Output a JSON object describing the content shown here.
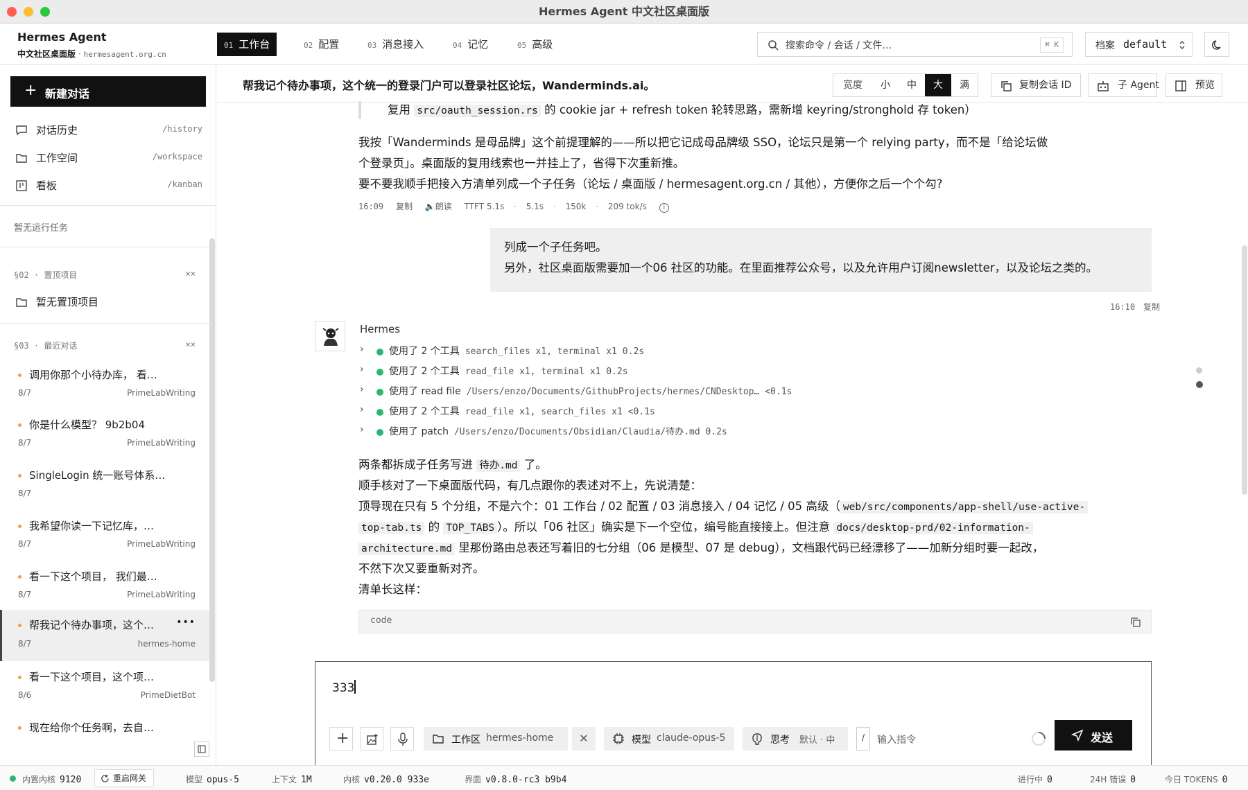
{
  "window": {
    "title": "Hermes Agent 中文社区桌面版"
  },
  "brand": {
    "name": "Hermes Agent",
    "subtitle": "中文社区桌面版",
    "separator": "·",
    "domain": "hermesagent.org.cn"
  },
  "tabs": [
    {
      "num": "01",
      "label": "工作台",
      "active": true
    },
    {
      "num": "02",
      "label": "配置"
    },
    {
      "num": "03",
      "label": "消息接入"
    },
    {
      "num": "04",
      "label": "记忆"
    },
    {
      "num": "05",
      "label": "高级"
    }
  ],
  "search": {
    "placeholder": "搜索命令 / 会话 / 文件…",
    "shortcut": "⌘ K"
  },
  "profile": {
    "label": "档案",
    "value": "default"
  },
  "sidebar": {
    "new_chat": "新建对话",
    "nav": [
      {
        "label": "对话历史",
        "path": "/history"
      },
      {
        "label": "工作空间",
        "path": "/workspace"
      },
      {
        "label": "看板",
        "path": "/kanban"
      }
    ],
    "no_tasks": "暂无运行任务",
    "pinned_header": "§02 · 置顶项目",
    "pinned_close": "××",
    "pinned_empty": "暂无置顶项目",
    "recent_header": "§03 · 最近对话",
    "recent_close": "××",
    "conversations": [
      {
        "title": "调用你那个小待办库， 看…",
        "date": "8/7",
        "project": "PrimeLabWriting"
      },
      {
        "title": "你是什么模型？ 9b2b04",
        "date": "8/7",
        "project": "PrimeLabWriting"
      },
      {
        "title": "SingleLogin 统一账号体系…",
        "date": "8/7",
        "project": ""
      },
      {
        "title": "我希望你读一下记忆库，…",
        "date": "8/7",
        "project": "PrimeLabWriting"
      },
      {
        "title": "看一下这个项目， 我们最…",
        "date": "8/7",
        "project": "PrimeLabWriting"
      },
      {
        "title": "帮我记个待办事项，这个…",
        "date": "8/7",
        "project": "hermes-home",
        "selected": true,
        "more": "•••"
      },
      {
        "title": "看一下这个项目，这个项…",
        "date": "8/6",
        "project": "PrimeDietBot"
      },
      {
        "title": "现在给你个任务啊，去自…",
        "date": "",
        "project": ""
      }
    ]
  },
  "conversation": {
    "title": "帮我记个待办事项，这个统一的登录门户可以登录社区论坛，Wanderminds.ai。",
    "width_label": "宽度",
    "widths": [
      "小",
      "中",
      "大",
      "满"
    ],
    "active_width": "大",
    "copy_id": "复制会话 ID",
    "sub_agent": "子 Agent",
    "preview": "预览"
  },
  "messages": {
    "prev_line_a": "复用",
    "prev_line_code": "src/oauth_session.rs",
    "prev_line_b": "的 cookie jar + refresh token 轮转思路，需新增 keyring/stronghold 存 token）",
    "prev_p1": "我按「Wanderminds 是母品牌」这个前提理解的——所以把它记成母品牌级 SSO，论坛只是第一个 relying party，而不是「给论坛做",
    "prev_p2": "个登录页」。桌面版的复用线索也一并挂上了，省得下次重新推。",
    "prev_p3": "要不要我顺手把接入方清单列成一个子任务（论坛 / 桌面版 / hermesagent.org.cn / 其他），方便你之后一个个勾?",
    "prev_meta": {
      "time": "16:09",
      "copy": "复制",
      "read": "朗读",
      "ttft": "TTFT 5.1s",
      "dur": "5.1s",
      "tokens": "150k",
      "speed": "209 tok/s"
    },
    "user_line1": "列成一个子任务吧。",
    "user_line2": "另外，社区桌面版需要加一个06 社区的功能。在里面推荐公众号，以及允许用户订阅newsletter，以及论坛之类的。",
    "user_meta": {
      "time": "16:10",
      "copy": "复制"
    },
    "agent_name": "Hermes",
    "tools": [
      {
        "label": "使用了 2 个工具",
        "detail": "search_files x1, terminal x1 0.2s"
      },
      {
        "label": "使用了 2 个工具",
        "detail": "read_file x1, terminal x1 0.2s"
      },
      {
        "label": "使用了 read file",
        "detail": "/Users/enzo/Documents/GithubProjects/hermes/CNDesktop… <0.1s"
      },
      {
        "label": "使用了 2 个工具",
        "detail": "read_file x1, search_files x1 <0.1s"
      },
      {
        "label": "使用了 patch",
        "detail": "/Users/enzo/Documents/Obsidian/Claudia/待办.md 0.2s"
      }
    ],
    "r1a": "两条都拆成子任务写进",
    "r1code": "待办.md",
    "r1b": "了。",
    "r2": "顺手核对了一下桌面版代码，有几点跟你的表述对不上，先说清楚：",
    "r3a": "顶导现在只有 5 个分组，不是六个：01 工作台 / 02 配置 / 03 消息接入 / 04 记忆 / 05 高级（",
    "r3code": "web/src/components/app-shell/use-active-",
    "r4code1": "top-tab.ts",
    "r4a": "的",
    "r4code2": "TOP_TABS",
    "r4b": "）。所以「06 社区」确实是下一个空位，编号能直接接上。但注意",
    "r4code3": "docs/desktop-prd/02-information-",
    "r5code": "architecture.md",
    "r5a": "里那份路由总表还写着旧的七分组（06 是模型、07 是 debug），文档跟代码已经漂移了——加新分组时要一起改，",
    "r6": "不然下次又要重新对齐。",
    "r7": "清单长这样：",
    "code_label": "code"
  },
  "composer": {
    "text": "333",
    "workspace_label": "工作区",
    "workspace_value": "hermes-home",
    "model_label": "模型",
    "model_value": "claude-opus-5",
    "think_label": "思考",
    "think_value": "默认 · 中",
    "cmd_slash": "/",
    "cmd_placeholder": "输入指令",
    "send": "发送"
  },
  "statusbar": {
    "kernel_label": "内置内核",
    "kernel_port": "9120",
    "restart": "重启网关",
    "model_label": "模型",
    "model_value": "opus-5",
    "context_label": "上下文",
    "context_value": "1M",
    "core_label": "内核",
    "core_value": "v0.20.0 933e",
    "ui_label": "界面",
    "ui_value": "v0.8.0-rc3 b9b4",
    "running_label": "进行中",
    "running_value": "0",
    "errors_label": "24H 错误",
    "errors_value": "0",
    "tokens_label": "今日 TOKENS",
    "tokens_value": "0"
  },
  "colors": {
    "accent": "#111111",
    "online": "#2bb673",
    "dot": "#e8a53a"
  }
}
